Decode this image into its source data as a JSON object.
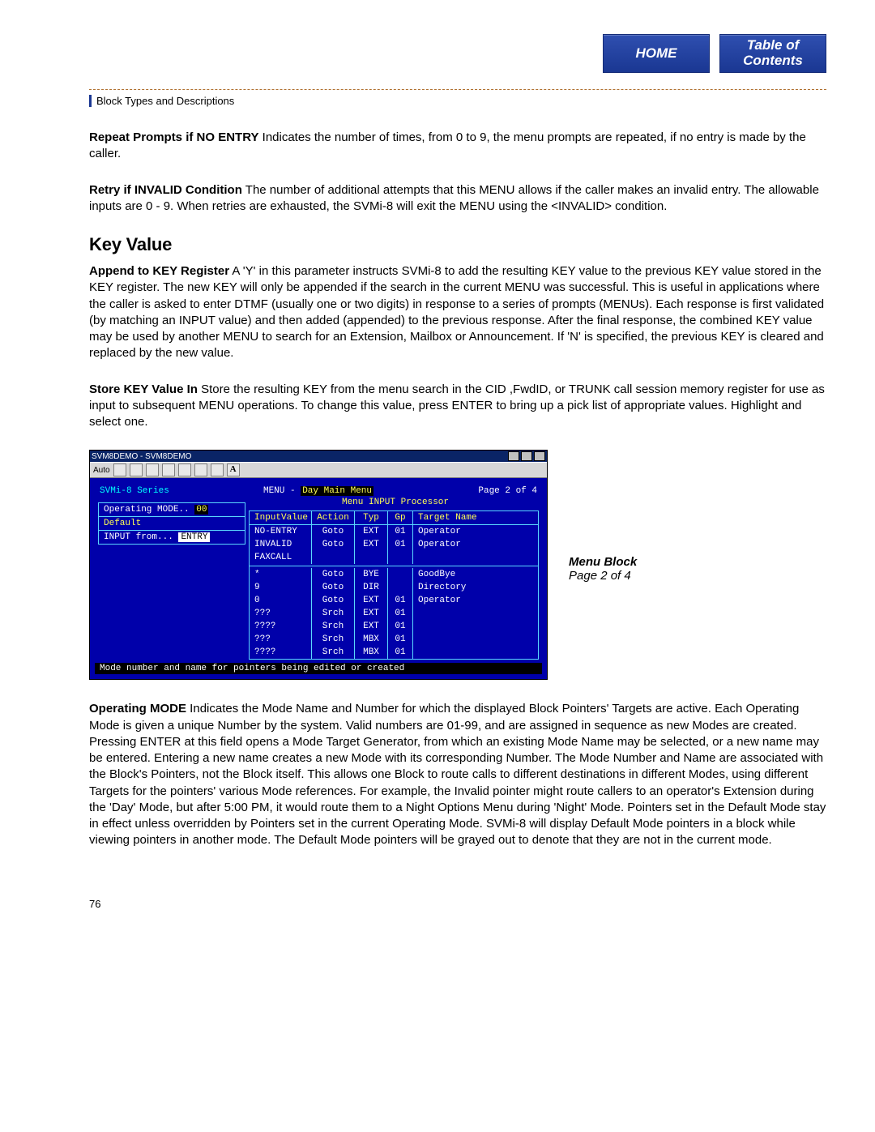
{
  "nav": {
    "home": "HOME",
    "toc_line1": "Table of",
    "toc_line2": "Contents"
  },
  "section_label": "Block Types and Descriptions",
  "paragraphs": {
    "p1_lead": "Repeat Prompts if NO ENTRY",
    "p1_body": "   Indicates the number of times, from 0 to 9, the menu prompts are repeated, if no entry is made by the caller.",
    "p2_lead": "Retry if INVALID Condition",
    "p2_body": "   The number of additional attempts that this MENU allows if the caller makes an invalid entry. The allowable inputs are 0 - 9. When retries are exhausted, the SVMi-8 will exit the MENU using the <INVALID> condition.",
    "h_keyvalue": "Key Value",
    "p3_lead": "Append to KEY Register",
    "p3_body": "   A 'Y' in this parameter instructs SVMi-8 to add the resulting KEY value to the previous KEY value stored in the KEY register. The new KEY will only be appended if the search in the current MENU was successful. This is useful in applications where the caller is asked to enter DTMF (usually one or two digits) in response to a series of prompts (MENUs). Each response is first validated (by matching an INPUT value) and then added (appended) to the previous response. After the final response, the combined KEY value may be used by another MENU to search for an Extension, Mailbox or Announcement. If 'N' is specified, the previous KEY is cleared and replaced by the new value.",
    "p4_lead": "Store KEY Value In",
    "p4_body": "   Store the resulting KEY from the menu search in the CID ,FwdID, or TRUNK call session memory register for use as input to subsequent MENU operations. To change this value, press ENTER to bring up a pick list of appropriate values. Highlight and select one.",
    "p5_lead": "Operating MODE",
    "p5_body": "   Indicates the Mode Name and Number for which the displayed Block Pointers' Targets are active. Each Operating Mode is given a unique Number by the system. Valid numbers are 01-99, and are assigned in sequence as new Modes are created. Pressing ENTER at this field opens a Mode Target Generator, from which an existing Mode Name may be selected, or a new name may be entered. Entering a new name creates a new Mode with its corresponding Number. The Mode Number and Name are associated with the Block's Pointers, not the Block itself. This allows one Block to route calls to different destinations in different Modes, using different Targets for the pointers' various Mode references. For example, the Invalid pointer might route callers to an operator's Extension during the 'Day' Mode, but after 5:00 PM, it would route them to a Night Options Menu during 'Night' Mode. Pointers set in the Default Mode stay in effect unless overridden by Pointers set in the current Operating Mode. SVMi-8 will display Default Mode pointers in a block while viewing pointers in another mode. The Default Mode pointers will be grayed out to denote that they are not in the current mode."
  },
  "terminal": {
    "window_title": "SVM8DEMO - SVM8DEMO",
    "toolbar_label": "Auto",
    "series": "SVMi-8 Series",
    "menu_label": "MENU -",
    "menu_field": "Day Main Menu",
    "page_label": "Page 2 of 4",
    "side": {
      "op_mode_label": "Operating MODE..",
      "op_mode_num": "00",
      "default_label": "Default",
      "input_from_label": "INPUT from...",
      "input_from_value": "ENTRY"
    },
    "menu_input_processor": "Menu INPUT Processor",
    "columns": {
      "iv": "InputValue",
      "ac": "Action",
      "ty": "Typ",
      "gp": "Gp",
      "tn": "Target Name"
    },
    "rows_top": [
      {
        "iv": "NO-ENTRY",
        "ac": "Goto",
        "ty": "EXT",
        "gp": "01",
        "tn": "Operator"
      },
      {
        "iv": "INVALID",
        "ac": "Goto",
        "ty": "EXT",
        "gp": "01",
        "tn": "Operator"
      },
      {
        "iv": "FAXCALL",
        "ac": "",
        "ty": "",
        "gp": "",
        "tn": ""
      }
    ],
    "rows_bottom": [
      {
        "iv": "*",
        "ac": "Goto",
        "ty": "BYE",
        "gp": "",
        "tn": "GoodBye"
      },
      {
        "iv": "9",
        "ac": "Goto",
        "ty": "DIR",
        "gp": "",
        "tn": "Directory"
      },
      {
        "iv": "0",
        "ac": "Goto",
        "ty": "EXT",
        "gp": "01",
        "tn": "Operator"
      },
      {
        "iv": "???",
        "ac": "Srch",
        "ty": "EXT",
        "gp": "01",
        "tn": ""
      },
      {
        "iv": "????",
        "ac": "Srch",
        "ty": "EXT",
        "gp": "01",
        "tn": ""
      },
      {
        "iv": "???",
        "ac": "Srch",
        "ty": "MBX",
        "gp": "01",
        "tn": ""
      },
      {
        "iv": "????",
        "ac": "Srch",
        "ty": "MBX",
        "gp": "01",
        "tn": ""
      }
    ],
    "status": "Mode number and name for pointers being edited or created"
  },
  "figure_caption": {
    "title": "Menu Block",
    "sub": "Page 2 of 4"
  },
  "page_number": "76"
}
